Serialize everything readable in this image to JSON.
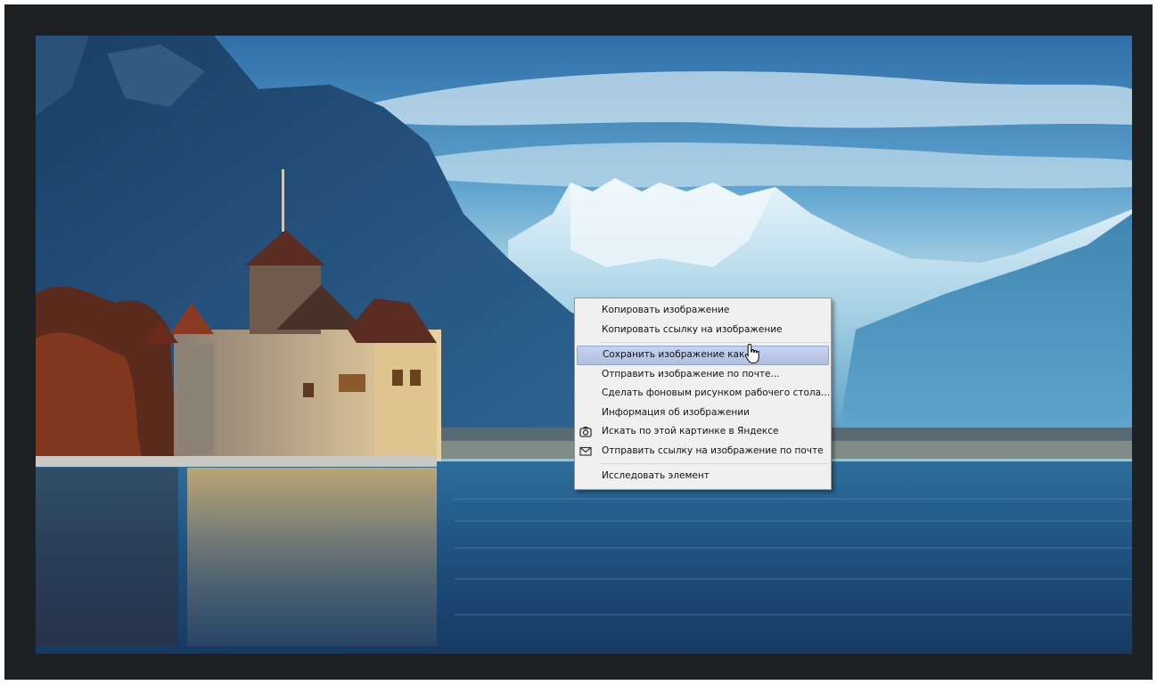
{
  "viewer": {
    "image_description_icon": "landscape-photo"
  },
  "context_menu": {
    "items": [
      {
        "label": "Копировать изображение",
        "icon": null
      },
      {
        "label": "Копировать ссылку на изображение",
        "icon": null
      },
      {
        "label": "Сохранить изображение как...",
        "icon": null,
        "highlighted": true
      },
      {
        "label": "Отправить изображение по почте...",
        "icon": null
      },
      {
        "label": "Сделать фоновым рисунком рабочего стола...",
        "icon": null
      },
      {
        "label": "Информация об изображении",
        "icon": null
      },
      {
        "label": "Искать по этой картинке в Яндексе",
        "icon": "camera-search-icon"
      },
      {
        "label": "Отправить ссылку на изображение по почте",
        "icon": "envelope-icon"
      },
      {
        "label": "Исследовать элемент",
        "icon": null
      }
    ]
  },
  "colors": {
    "frame": "#1d2124",
    "menu_background": "#f0f0f0",
    "menu_highlight": "#b8c8e8",
    "menu_border": "#979797"
  },
  "cursor": {
    "icon": "hand-pointer-icon"
  }
}
